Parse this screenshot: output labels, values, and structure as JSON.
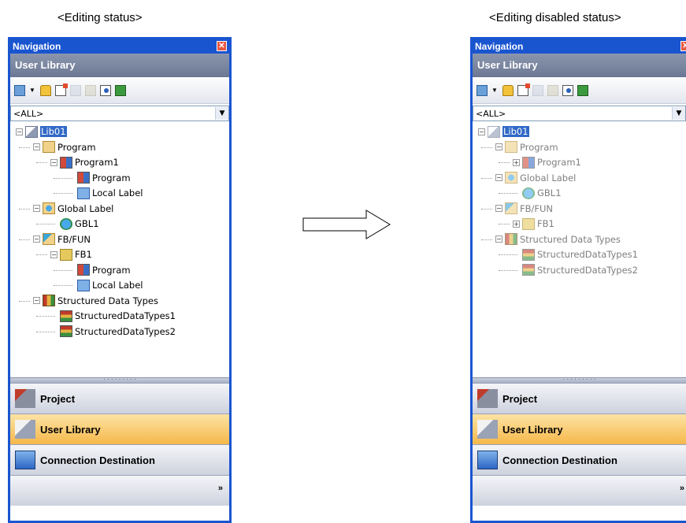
{
  "left": {
    "caption": "<Editing status>",
    "title": "Navigation",
    "header": "User Library",
    "filter_value": "<ALL>",
    "tree": [
      {
        "label": "Lib01",
        "level": 0,
        "exp": "-",
        "icon": "library-icon",
        "selected": true
      },
      {
        "label": "Program",
        "level": 1,
        "exp": "-",
        "icon": "folder-icon"
      },
      {
        "label": "Program1",
        "level": 2,
        "exp": "-",
        "icon": "program-block-icon"
      },
      {
        "label": "Program",
        "level": 3,
        "exp": "",
        "icon": "program-icon"
      },
      {
        "label": "Local Label",
        "level": 3,
        "exp": "",
        "icon": "label-icon"
      },
      {
        "label": "Global Label",
        "level": 1,
        "exp": "-",
        "icon": "globe-folder-icon"
      },
      {
        "label": "GBL1",
        "level": 2,
        "exp": "",
        "icon": "globe-icon"
      },
      {
        "label": "FB/FUN",
        "level": 1,
        "exp": "-",
        "icon": "fb-folder-icon"
      },
      {
        "label": "FB1",
        "level": 2,
        "exp": "-",
        "icon": "fb-icon"
      },
      {
        "label": "Program",
        "level": 3,
        "exp": "",
        "icon": "program-icon"
      },
      {
        "label": "Local Label",
        "level": 3,
        "exp": "",
        "icon": "label-icon"
      },
      {
        "label": "Structured Data Types",
        "level": 1,
        "exp": "-",
        "icon": "struct-folder-icon"
      },
      {
        "label": "StructuredDataTypes1",
        "level": 2,
        "exp": "",
        "icon": "struct-icon"
      },
      {
        "label": "StructuredDataTypes2",
        "level": 2,
        "exp": "",
        "icon": "struct-icon"
      }
    ],
    "sections": [
      "Project",
      "User Library",
      "Connection Destination"
    ],
    "more": "»"
  },
  "right": {
    "caption": "<Editing disabled status>",
    "title": "Navigation",
    "header": "User Library",
    "filter_value": "<ALL>",
    "tree": [
      {
        "label": "Lib01",
        "level": 0,
        "exp": "-",
        "icon": "library-icon",
        "selected": true
      },
      {
        "label": "Program",
        "level": 1,
        "exp": "-",
        "icon": "folder-icon"
      },
      {
        "label": "Program1",
        "level": 2,
        "exp": "+",
        "icon": "program-block-icon"
      },
      {
        "label": "Global Label",
        "level": 1,
        "exp": "-",
        "icon": "globe-folder-icon"
      },
      {
        "label": "GBL1",
        "level": 2,
        "exp": "",
        "icon": "globe-icon"
      },
      {
        "label": "FB/FUN",
        "level": 1,
        "exp": "-",
        "icon": "fb-folder-icon"
      },
      {
        "label": "FB1",
        "level": 2,
        "exp": "+",
        "icon": "fb-icon"
      },
      {
        "label": "Structured Data Types",
        "level": 1,
        "exp": "-",
        "icon": "struct-folder-icon"
      },
      {
        "label": "StructuredDataTypes1",
        "level": 2,
        "exp": "",
        "icon": "struct-icon"
      },
      {
        "label": "StructuredDataTypes2",
        "level": 2,
        "exp": "",
        "icon": "struct-icon"
      }
    ],
    "sections": [
      "Project",
      "User Library",
      "Connection Destination"
    ],
    "more": "»"
  },
  "colors": {
    "window_frame": "#1a55d0",
    "header_bg": "#7a85a0",
    "active_section": "#f5b84a",
    "selection": "#3169c6"
  }
}
